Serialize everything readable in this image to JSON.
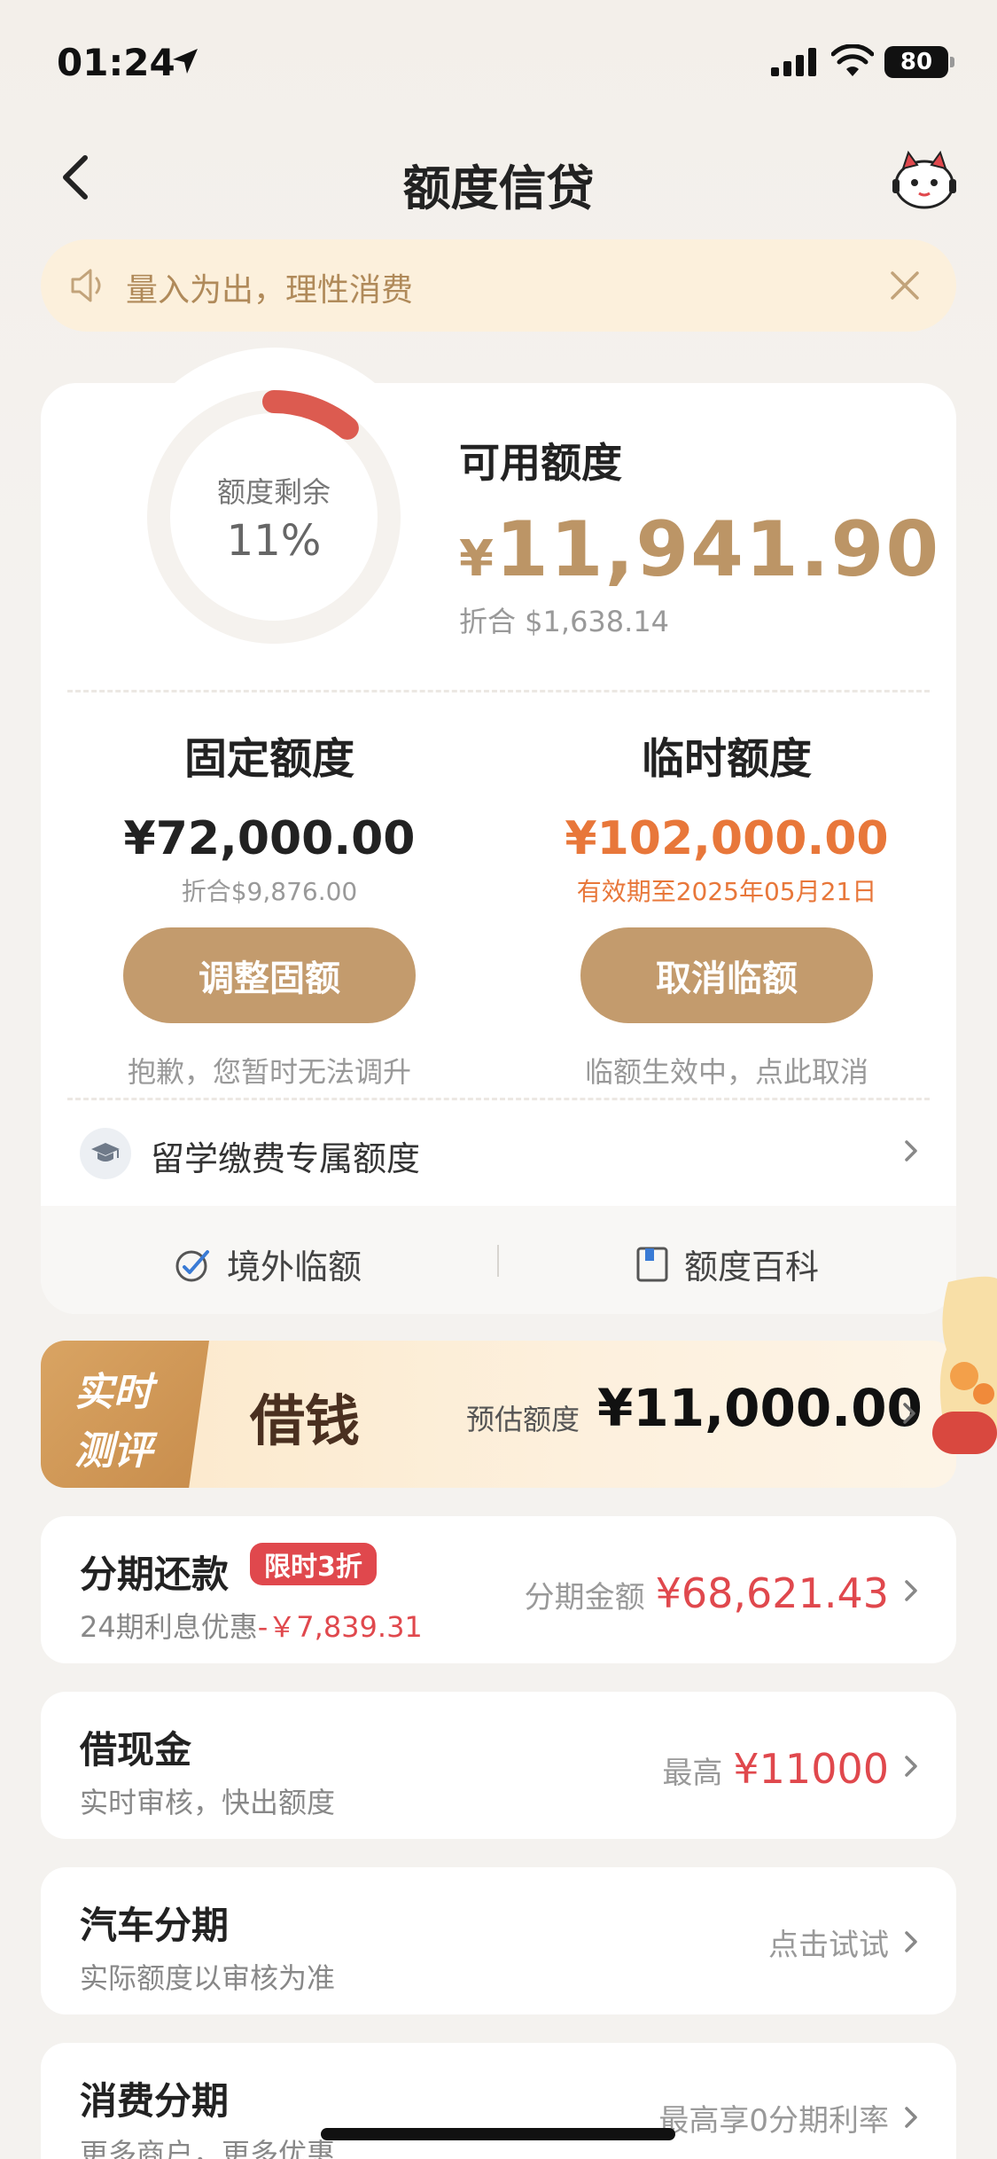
{
  "status": {
    "time": "01:24",
    "battery": "80"
  },
  "nav": {
    "title": "额度信贷"
  },
  "notice": {
    "text": "量入为出，理性消费"
  },
  "summary": {
    "gauge_label": "额度剩余",
    "gauge_percent_text": "11%",
    "remaining_fraction": 0.11,
    "available_label": "可用额度",
    "available_currency": "¥",
    "available_amount": "11,941.90",
    "available_usd": "折合 $1,638.14"
  },
  "fixed": {
    "title": "固定额度",
    "amount": "¥72,000.00",
    "sub": "折合$9,876.00",
    "button": "调整固额",
    "hint": "抱歉，您暂时无法调升"
  },
  "temp": {
    "title": "临时额度",
    "amount": "¥102,000.00",
    "sub": "有效期至2025年05月21日",
    "button": "取消临额",
    "hint": "临额生效中，点此取消"
  },
  "study": {
    "label": "留学缴费专属额度"
  },
  "footer": {
    "overseas": "境外临额",
    "wiki": "额度百科"
  },
  "banner": {
    "tag_line1": "实时",
    "tag_line2": "测评",
    "title": "借钱",
    "estimate_label": "预估额度",
    "estimate_amount": "¥11,000.00"
  },
  "list": [
    {
      "title": "分期还款",
      "badge": "限时3折",
      "subtitle": "24期利息优惠",
      "subtitle_extra": "-￥7,839.31",
      "right_label": "分期金额",
      "right_value": "¥68,621.43"
    },
    {
      "title": "借现金",
      "subtitle": "实时审核，快出额度",
      "right_label": "最高",
      "right_value": "¥11000"
    },
    {
      "title": "汽车分期",
      "subtitle": "实际额度以审核为准",
      "right_label": "点击试试"
    },
    {
      "title": "消费分期",
      "subtitle": "更多商户，更多优惠",
      "right_label": "最高享0分期利率"
    }
  ],
  "colors": {
    "accent": "#c39b6d",
    "gold_text": "#bc9566",
    "red": "#e0484d",
    "orange": "#e8773a"
  }
}
